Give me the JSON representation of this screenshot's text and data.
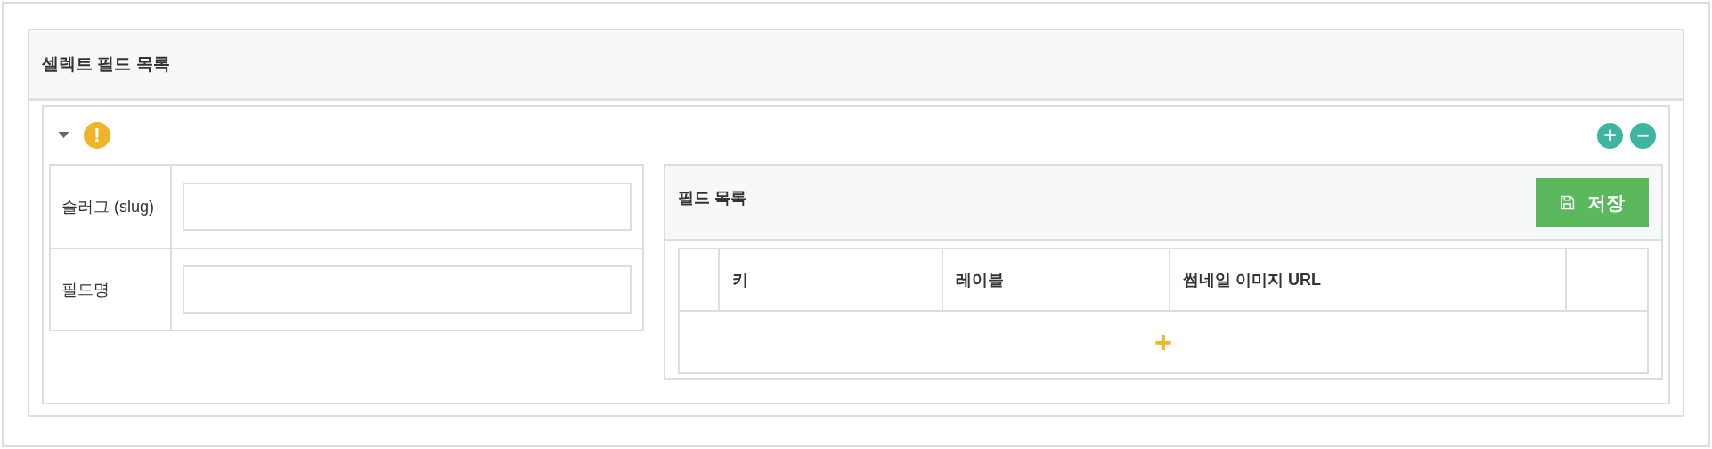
{
  "panel": {
    "title": "셀렉트 필드 목록"
  },
  "item": {
    "expanded": true,
    "warning_icon": "!",
    "add_label": "+",
    "remove_label": "−"
  },
  "form_rows": [
    {
      "label": "슬러그 (slug)",
      "value": ""
    },
    {
      "label": "필드명",
      "value": ""
    }
  ],
  "field_list": {
    "title": "필드 목록",
    "save_button": "저장",
    "columns": [
      "",
      "키",
      "레이블",
      "썸네일 이미지 URL",
      ""
    ],
    "add_row": "+"
  }
}
